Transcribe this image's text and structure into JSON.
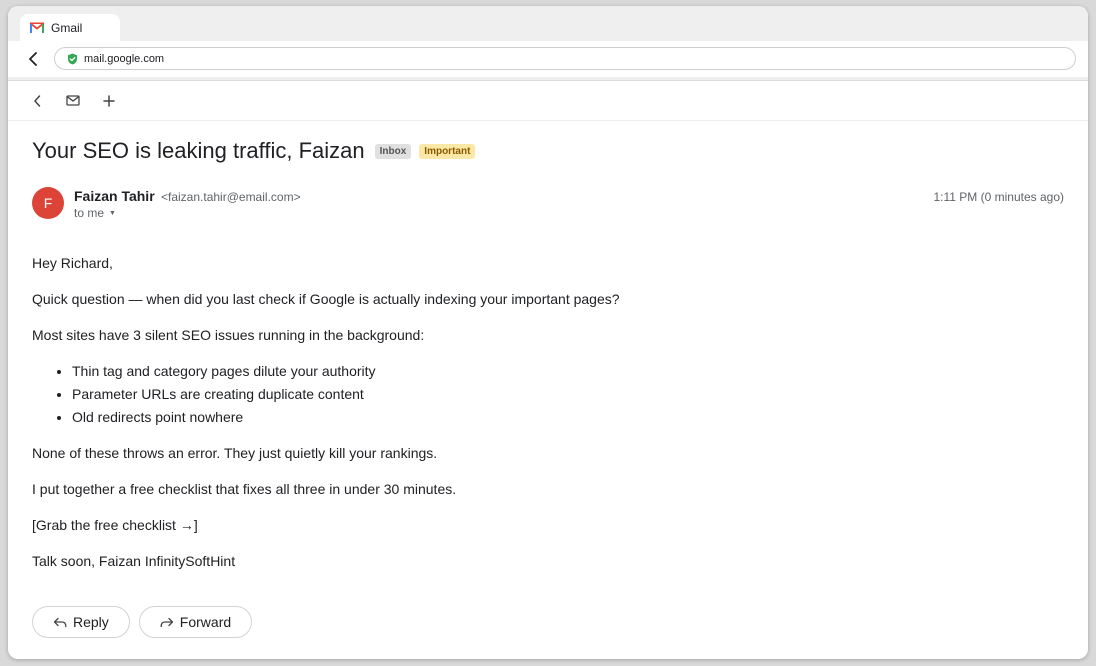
{
  "browser": {
    "tab_title": "Gmail",
    "url": "mail.google.com"
  },
  "email": {
    "subject": "Your SEO is leaking traffic, Faizan",
    "labels": [
      "Inbox",
      "Important"
    ],
    "sender_name": "Faizan Tahir",
    "sender_email": "<faizan.tahir@email.com>",
    "sender_initial": "F",
    "recipient": "to me",
    "time": "1:11 PM (0 minutes ago)",
    "greeting": "Hey Richard,",
    "paragraph1": "Quick question — when did you last check if Google is actually indexing your important pages?",
    "paragraph2": "Most sites have 3 silent SEO issues running in the background:",
    "bullets": [
      "Thin tag and category pages dilute your authority",
      "Parameter URLs are creating duplicate content",
      "Old redirects point nowhere"
    ],
    "paragraph3": "None of these throws an error. They just quietly kill your rankings.",
    "paragraph4": "I put together a free checklist that fixes all three in under 30 minutes.",
    "cta": "[Grab the free checklist →]",
    "signoff": "Talk soon, Faizan InfinitySoftHint"
  },
  "actions": {
    "reply_label": "Reply",
    "forward_label": "Forward"
  },
  "colors": {
    "avatar": "#db4437",
    "important_badge": "#fce8a6",
    "inbox_badge": "#e0e0e0",
    "secure_icon": "#34a853"
  }
}
